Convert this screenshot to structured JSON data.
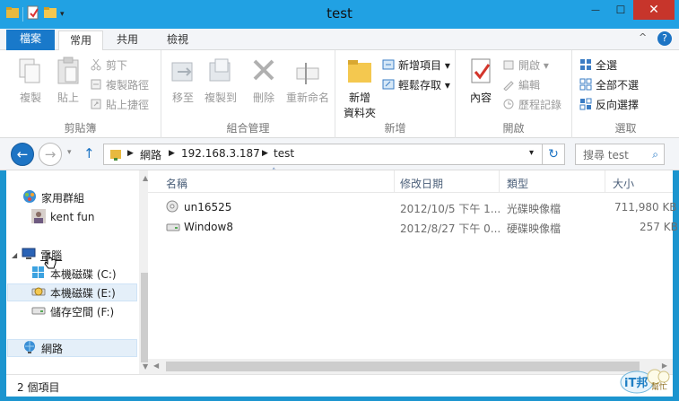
{
  "window": {
    "title": "test",
    "close_glyph": "✕",
    "minimize_glyph": "—",
    "maximize_glyph": "☐"
  },
  "ribbon_tabs": [
    "檔案",
    "常用",
    "共用",
    "檢視"
  ],
  "ribbon_controls": {
    "collapse": "^",
    "help": "?"
  },
  "groups": {
    "clipboard": {
      "name": "剪貼簿",
      "copy": "複製",
      "paste": "貼上",
      "cut": "剪下",
      "copy_path": "複製路徑",
      "paste_shortcut": "貼上捷徑"
    },
    "organize": {
      "name": "組合管理",
      "move_to": "移至",
      "copy_to": "複製到",
      "delete": "刪除",
      "rename": "重新命名"
    },
    "new": {
      "name": "新增",
      "new_folder_line1": "新增",
      "new_folder_line2": "資料夾",
      "new_item": "新增項目 ▾",
      "easy_access": "輕鬆存取 ▾"
    },
    "open": {
      "name": "開啟",
      "properties": "內容",
      "open": "開啟 ▾",
      "edit": "編輯",
      "history": "歷程記錄"
    },
    "select": {
      "name": "選取",
      "select_all": "全選",
      "select_none": "全部不選",
      "invert": "反向選擇"
    }
  },
  "address": {
    "crumbs": [
      "網路",
      "192.168.3.187",
      "test"
    ],
    "separator": "▶",
    "dropdown": "▾",
    "refresh_glyph": "↻",
    "search_placeholder": "搜尋 test",
    "search_glyph": "⌕"
  },
  "nav_pane": {
    "items": [
      {
        "label": "家用群組"
      },
      {
        "label": "kent fun"
      },
      {
        "label": "電腦"
      },
      {
        "label": "本機磁碟 (C:)"
      },
      {
        "label": "本機磁碟 (E:)"
      },
      {
        "label": "儲存空間 (F:)"
      },
      {
        "label": "網路"
      }
    ]
  },
  "files": {
    "columns": [
      "名稱",
      "修改日期",
      "類型",
      "大小"
    ],
    "sort_arrow": "˄",
    "rows": [
      {
        "name": "un16525",
        "date": "2012/10/5 下午 1...",
        "type": "光碟映像檔",
        "size": "711,980 KB"
      },
      {
        "name": "Window8",
        "date": "2012/8/27 下午 0...",
        "type": "硬碟映像檔",
        "size": "257 KB"
      }
    ]
  },
  "status": {
    "item_count": "2 個項目"
  },
  "watermark": {
    "text_line1": "iT邦",
    "text_line2": "幫忙"
  },
  "colors": {
    "title_bar": "#21a1e3",
    "file_tab": "#1979ca",
    "close_button": "#c7352b",
    "accent": "#1d74c4"
  }
}
